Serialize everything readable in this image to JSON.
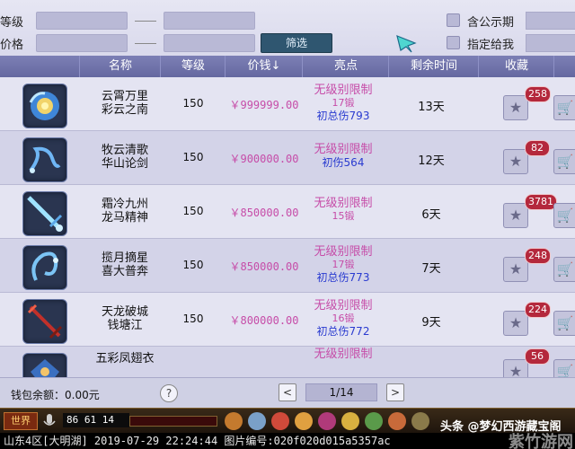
{
  "filter": {
    "level_label": "等级",
    "price_label": "价格",
    "filter_button": "筛选",
    "public_label": "含公示期",
    "assign_label": "指定给我"
  },
  "table": {
    "headers": [
      "名称",
      "等级",
      "价钱↓",
      "亮点",
      "剩余时间",
      "收藏"
    ],
    "rows": [
      {
        "name1": "云霄万里",
        "name2": "彩云之南",
        "level": "150",
        "price": "￥999999.00",
        "hl1": "无级别限制",
        "hl2": "17锻",
        "hl3": "初总伤793",
        "time": "13天",
        "fav_count": "258",
        "icon": "blue-wing-amulet-icon"
      },
      {
        "name1": "牧云清歌",
        "name2": "华山论剑",
        "level": "150",
        "price": "￥900000.00",
        "hl1": "无级别限制",
        "hl2": "",
        "hl3": "初伤564",
        "time": "12天",
        "fav_count": "82",
        "icon": "blue-whip-icon"
      },
      {
        "name1": "霜冷九州",
        "name2": "龙马精神",
        "level": "150",
        "price": "￥850000.00",
        "hl1": "无级别限制",
        "hl2": "15锻",
        "hl3": "",
        "time": "6天",
        "fav_count": "3781",
        "icon": "ice-sword-icon"
      },
      {
        "name1": "揽月摘星",
        "name2": "喜大普奔",
        "level": "150",
        "price": "￥850000.00",
        "hl1": "无级别限制",
        "hl2": "17锻",
        "hl3": "初总伤773",
        "time": "7天",
        "fav_count": "248",
        "icon": "blue-ring-icon"
      },
      {
        "name1": "天龙破城",
        "name2": "钱塘江",
        "level": "150",
        "price": "￥800000.00",
        "hl1": "无级别限制",
        "hl2": "16锻",
        "hl3": "初总伤772",
        "time": "9天",
        "fav_count": "224",
        "icon": "red-spear-icon"
      },
      {
        "name1": "五彩凤翅衣",
        "name2": "",
        "level": "",
        "price": "",
        "hl1": "无级别限制",
        "hl2": "",
        "hl3": "",
        "time": "",
        "fav_count": "56",
        "icon": "phoenix-armor-icon"
      }
    ]
  },
  "footer": {
    "wallet": "钱包余额：0.00元",
    "help": "?",
    "prev": "<",
    "next": ">",
    "page": "1/14"
  },
  "gamebar": {
    "world": "世界",
    "coord": "86 61 14"
  },
  "watermark": {
    "top": "头条 @梦幻西游藏宝阁",
    "bottom": "紫竹游网"
  },
  "status": "山东4区[大明湖] 2019-07-29 22:24:44 图片编号:020f020d015a5357ac"
}
